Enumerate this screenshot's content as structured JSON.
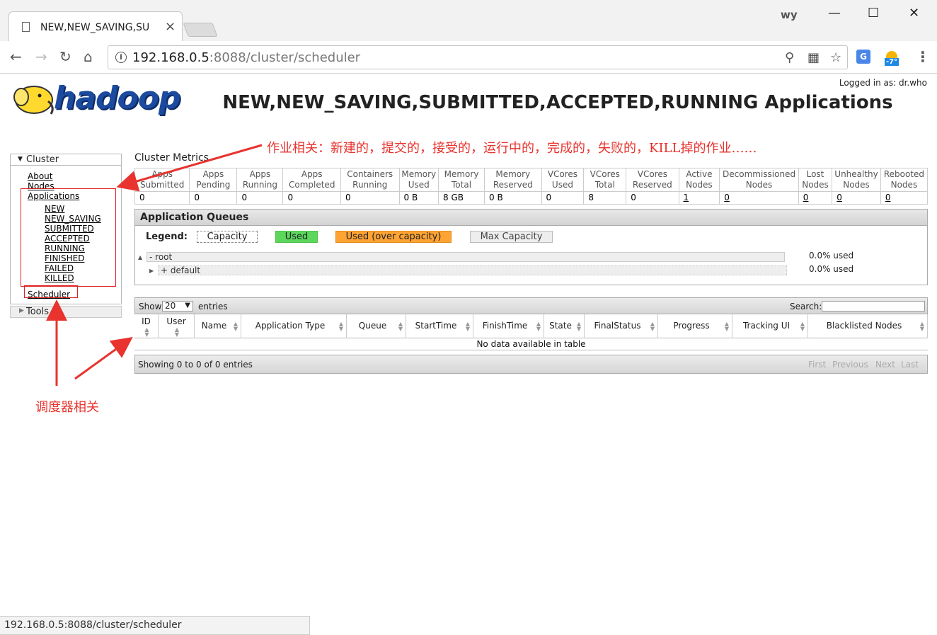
{
  "browser": {
    "tab_title": "NEW,NEW_SAVING,SU",
    "user": "wy",
    "url_host": "192.168.0.5",
    "url_path": ":8088/cluster/scheduler",
    "status_url": "192.168.0.5:8088/cluster/scheduler",
    "weather_temp": "-7°"
  },
  "header": {
    "logo_text": "hadoop",
    "logged_in": "Logged in as: dr.who",
    "title": "NEW,NEW_SAVING,SUBMITTED,ACCEPTED,RUNNING Applications"
  },
  "annotations": {
    "apps_note": "作业相关：新建的，提交的，接受的，运行中的，完成的，失败的，KILL掉的作业……",
    "scheduler_note": "调度器相关"
  },
  "sidebar": {
    "cluster_label": "Cluster",
    "about": "About",
    "nodes": "Nodes",
    "applications": "Applications",
    "app_states": [
      "NEW",
      "NEW_SAVING",
      "SUBMITTED",
      "ACCEPTED",
      "RUNNING",
      "FINISHED",
      "FAILED",
      "KILLED"
    ],
    "scheduler": "Scheduler",
    "tools_label": "Tools"
  },
  "metrics": {
    "title": "Cluster Metrics",
    "headers": [
      "Apps Submitted",
      "Apps Pending",
      "Apps Running",
      "Apps Completed",
      "Containers Running",
      "Memory Used",
      "Memory Total",
      "Memory Reserved",
      "VCores Used",
      "VCores Total",
      "VCores Reserved",
      "Active Nodes",
      "Decommissioned Nodes",
      "Lost Nodes",
      "Unhealthy Nodes",
      "Rebooted Nodes"
    ],
    "values": [
      "0",
      "0",
      "0",
      "0",
      "0",
      "0 B",
      "8 GB",
      "0 B",
      "0",
      "8",
      "0",
      "1",
      "0",
      "0",
      "0",
      "0"
    ]
  },
  "queues": {
    "title": "Application Queues",
    "legend_label": "Legend:",
    "legend": {
      "capacity": "Capacity",
      "used": "Used",
      "over": "Used (over capacity)",
      "max": "Max Capacity"
    },
    "colors": {
      "used": "#5bd75b",
      "over": "#ffa333"
    },
    "root_label": "- root",
    "root_used": "0.0% used",
    "default_label": "+ default",
    "default_used": "0.0% used"
  },
  "apps_table": {
    "show": "Show",
    "page_size": "20",
    "entries": "entries",
    "search": "Search:",
    "columns": [
      "ID",
      "User",
      "Name",
      "Application Type",
      "Queue",
      "StartTime",
      "FinishTime",
      "State",
      "FinalStatus",
      "Progress",
      "Tracking UI",
      "Blacklisted Nodes"
    ],
    "empty": "No data available in table",
    "info": "Showing 0 to 0 of 0 entries",
    "pager": [
      "First",
      "Previous",
      "Next",
      "Last"
    ]
  }
}
